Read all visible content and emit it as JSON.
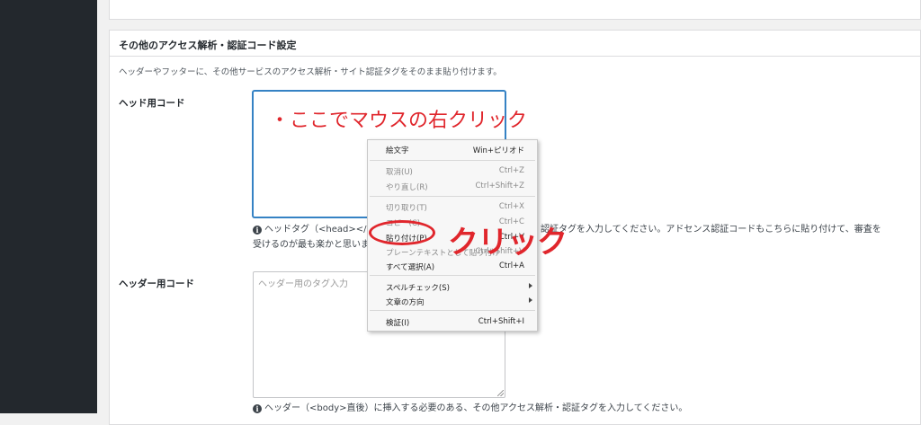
{
  "section": {
    "title": "その他のアクセス解析・認証コード設定",
    "description": "ヘッダーやフッターに、その他サービスのアクセス解析・サイト認証タグをそのまま貼り付けます。"
  },
  "head_code": {
    "label": "ヘッド用コード",
    "value": "",
    "help_left": "ヘッドタグ（<head></hea",
    "help_right": "ス解析・認証タグを入力してください。アドセンス認証コードもこちらに貼り付けて、審査を",
    "help_line2": "受けるのが最も楽かと思いま"
  },
  "header_code": {
    "label": "ヘッダー用コード",
    "placeholder": "ヘッダー用のタグ入力",
    "help": "ヘッダー（<body>直後）に挿入する必要のある、その他アクセス解析・認証タグを入力してください。"
  },
  "annotations": {
    "instruction": "・ここでマウスの右クリック",
    "click": "クリック",
    "color": "#e0262c"
  },
  "context_menu": {
    "items": [
      {
        "label": "絵文字",
        "shortcut": "Win+ピリオド",
        "disabled": false
      },
      {
        "label": "取消(U)",
        "shortcut": "Ctrl+Z",
        "disabled": true
      },
      {
        "label": "やり直し(R)",
        "shortcut": "Ctrl+Shift+Z",
        "disabled": true
      },
      {
        "label": "切り取り(T)",
        "shortcut": "Ctrl+X",
        "disabled": true
      },
      {
        "label": "コピー(C)",
        "shortcut": "Ctrl+C",
        "disabled": true
      },
      {
        "label": "貼り付け(P)",
        "shortcut": "Ctrl+V",
        "disabled": false
      },
      {
        "label": "プレーンテキストとして貼り付け",
        "shortcut": "Ctrl+Shift+V",
        "disabled": true
      },
      {
        "label": "すべて選択(A)",
        "shortcut": "Ctrl+A",
        "disabled": false
      },
      {
        "label": "スペルチェック(S)",
        "shortcut": "",
        "disabled": false
      },
      {
        "label": "文章の方向",
        "shortcut": "",
        "disabled": false
      },
      {
        "label": "検証(I)",
        "shortcut": "Ctrl+Shift+I",
        "disabled": false
      }
    ]
  },
  "icons": {
    "info": "info-circle-icon",
    "submenu": "chevron-right-icon"
  }
}
